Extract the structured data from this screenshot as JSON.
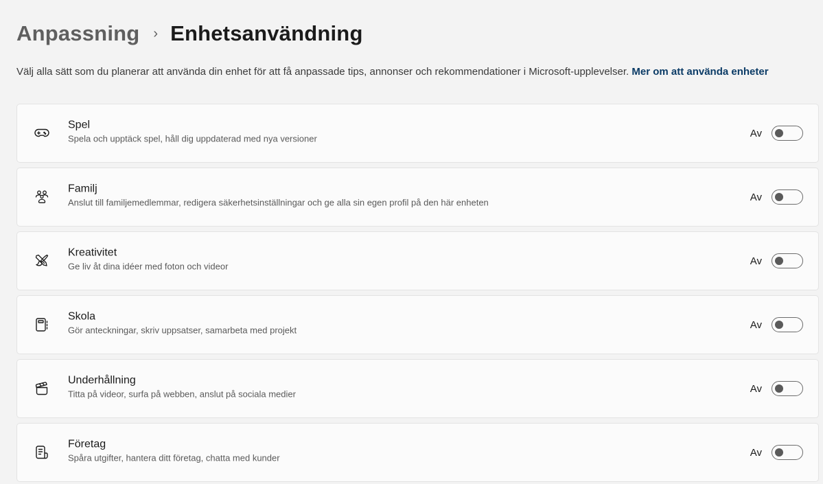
{
  "breadcrumb": {
    "parent": "Anpassning",
    "separator": "›",
    "current": "Enhetsanvändning"
  },
  "description": {
    "text": "Välj alla sätt som du planerar att använda din enhet för att få anpassade tips, annonser och rekommendationer i Microsoft-upplevelser.",
    "link": "Mer om att använda enheter"
  },
  "colors": {
    "background": "#f3f3f3",
    "card": "#fbfbfb",
    "link": "#0b3b66"
  },
  "cards": [
    {
      "icon": "gamepad-icon",
      "title": "Spel",
      "subtitle": "Spela och upptäck spel, håll dig uppdaterad med nya versioner",
      "state": "Av"
    },
    {
      "icon": "family-icon",
      "title": "Familj",
      "subtitle": "Anslut till familjemedlemmar, redigera säkerhetsinställningar och ge alla sin egen profil på den här enheten",
      "state": "Av"
    },
    {
      "icon": "brush-pen-icon",
      "title": "Kreativitet",
      "subtitle": "Ge liv åt dina idéer med foton och videor",
      "state": "Av"
    },
    {
      "icon": "notebook-icon",
      "title": "Skola",
      "subtitle": "Gör anteckningar, skriv uppsatser, samarbeta med projekt",
      "state": "Av"
    },
    {
      "icon": "clapperboard-icon",
      "title": "Underhållning",
      "subtitle": "Titta på videor, surfa på webben, anslut på sociala medier",
      "state": "Av"
    },
    {
      "icon": "receipt-icon",
      "title": "Företag",
      "subtitle": "Spåra utgifter, hantera ditt företag, chatta med kunder",
      "state": "Av"
    }
  ]
}
